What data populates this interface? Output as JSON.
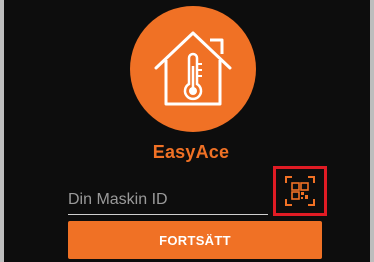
{
  "app": {
    "name": "EasyAce",
    "logo_icon": "house-thermometer-icon",
    "brand_color": "#f07125"
  },
  "form": {
    "machine_id_placeholder": "Din Maskin ID",
    "machine_id_value": "",
    "qr_icon": "qr-code-scan-icon",
    "qr_highlight_color": "#e01b24",
    "continue_label": "FORTSÄTT"
  }
}
